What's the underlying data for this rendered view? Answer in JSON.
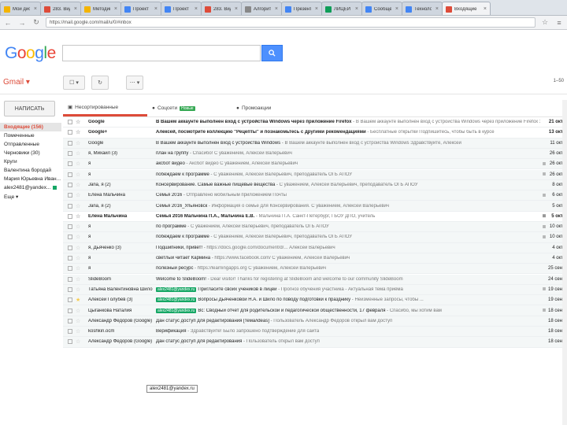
{
  "browser": {
    "tabs": [
      {
        "label": "Мой диск",
        "color": "#f4b400"
      },
      {
        "label": "283. Видео",
        "color": "#dd4b39"
      },
      {
        "label": "Методика",
        "color": "#f4b400"
      },
      {
        "label": "Проект",
        "color": "#4285f4"
      },
      {
        "label": "Проект",
        "color": "#4285f4"
      },
      {
        "label": "283. Видео",
        "color": "#dd4b39"
      },
      {
        "label": "Алгоритм",
        "color": "#888888"
      },
      {
        "label": "Презентация",
        "color": "#4285f4"
      },
      {
        "label": "ЛИЦЕЙ",
        "color": "#0f9d58"
      },
      {
        "label": "Сообщения",
        "color": "#4285f4"
      },
      {
        "label": "Технолог",
        "color": "#4285f4"
      },
      {
        "label": "Входящие",
        "color": "#dd4b39"
      }
    ],
    "url": "https://mail.google.com/mail/u/0/#inbox"
  },
  "header": {
    "logo": "Google",
    "search_placeholder": ""
  },
  "toolbar": {
    "app_label": "Gmail ▾",
    "pager": "1–50"
  },
  "sidebar": {
    "compose": "НАПИСАТЬ",
    "items": [
      {
        "label": "Входящие (156)",
        "active": true
      },
      {
        "label": "Помеченные"
      },
      {
        "label": "Отправленные"
      },
      {
        "label": "Черновики (30)"
      },
      {
        "label": "Круги"
      },
      {
        "label": "Валентина бородай"
      },
      {
        "label": "Мария Юрьевна Иван...",
        "dot": "#dd4b39"
      },
      {
        "label": "alex2481@yandex...",
        "dot": "#16a765"
      },
      {
        "label": "Еще ▾"
      }
    ]
  },
  "categories": [
    {
      "label": "Несортированные",
      "icon": "inbox-icon",
      "active": true
    },
    {
      "label": "Соцсети",
      "badge": "Новые"
    },
    {
      "label": "Промоакции"
    }
  ],
  "emails": [
    {
      "sender": "Google",
      "subject": "В Вашем аккаунте выполнен вход с устройства Windows через приложение Firefox",
      "snippet": " - В Вашем аккаунте выполнен вход с устройства Windows через приложение Firefox Здравствуйте, Але",
      "date": "21 окт.",
      "unread": true
    },
    {
      "sender": "Google+",
      "subject": "Алексей, посмотрите коллекцию \"Рецепты\" и познакомьтесь с другими рекомендациями",
      "snippet": " - Бесплатные открытки Подпишитесь, чтобы быть в курсе",
      "date": "13 окт.",
      "unread": true
    },
    {
      "sender": "Google",
      "subject": "В Вашем аккаунте выполнен вход с устройства Windows",
      "snippet": " - В Вашем аккаунте выполнен вход с устройства Windows Здравствуйте, Алексей",
      "date": "11 окт.",
      "unread": false
    },
    {
      "sender": "я, Михаил (3)",
      "subject": "план на группу",
      "snippet": " - Спасибо! С уважением, Алексей Валерьевич",
      "date": "26 окт.",
      "unread": false
    },
    {
      "sender": "я",
      "subject": "аксбот видео",
      "snippet": " - Аксбот видео С уважением, Алексей Валерьевич",
      "date": "26 окт.",
      "unread": false,
      "attach": true
    },
    {
      "sender": "я",
      "subject": "побеждаем к программе",
      "snippet": " - С уважением, Алексей Валерьевич, преподаватель ОГБ АПОУ",
      "date": "26 окт.",
      "unread": false,
      "attach": true
    },
    {
      "sender": "Jana, я (2)",
      "subject": "Консервирование. Самые важные пищевые вещества",
      "snippet": " - С уважением, Алексей Валерьевич, преподаватель ОГБ АПОУ",
      "date": "8 окт.",
      "unread": false
    },
    {
      "sender": "Елена Мальчина",
      "subject": "Семья 2016",
      "snippet": " - Отправлено мобильным приложением Почты",
      "date": "6 окт.",
      "unread": false,
      "attach": true
    },
    {
      "sender": "Jana, я (2)",
      "subject": "Семья 2016_Ульяновск",
      "snippet": " - Информация о семье для Консервирования. С уважением, Алексей Валерьевич",
      "date": "5 окт.",
      "unread": false
    },
    {
      "sender": "Елена Мальчина",
      "subject": "Семья 2016 Мальчина П.А., Мальчина Е.В.",
      "snippet": " - Мальчина П.А. Санкт-Петербург, ГБОУ ДПО, учитель",
      "date": "5 окт.",
      "unread": true,
      "attach": true
    },
    {
      "sender": "я",
      "subject": "по программе",
      "snippet": " - С уважением, Алексей Валерьевич, преподаватель ОГБ АПОУ",
      "date": "10 окт.",
      "unread": false,
      "attach": true
    },
    {
      "sender": "я",
      "subject": "побеждаем к программе",
      "snippet": " - С уважением, Алексей Валерьевич, преподаватель ОГБ АПОУ",
      "date": "10 окт.",
      "unread": false,
      "attach": true
    },
    {
      "sender": "я, Дьяченко (3)",
      "subject": "Подшипники, привет!",
      "snippet": " - https://docs.google.com/document/d/... Алексей Валерьевич",
      "date": "4 окт.",
      "unread": false
    },
    {
      "sender": "я",
      "subject": "светлый читает Кармина",
      "snippet": " - https://www.facebook.com/ С уважением, Алексей Валерьевич",
      "date": "4 окт.",
      "unread": false
    },
    {
      "sender": "я",
      "subject": "полезный ресурс",
      "snippet": " - https://learningapps.org С уважением, Алексей Валерьевич",
      "date": "25 сент.",
      "unread": false
    },
    {
      "sender": "SlideBoom",
      "subject": "Welcome to SlideBoom!",
      "snippet": " - Dear visitor! Thanks for registering at SlideBoom and welcome to our community SlideBoom",
      "date": "24 сент.",
      "unread": false
    },
    {
      "sender": "Татьяна Валентиновна Шило",
      "label": "alex2481@yandex.ru",
      "subject": "Пригласите своих учеников в лицей",
      "snippet": " - Прогноз обучения участника - Актуальная тема приёма",
      "date": "19 сент.",
      "unread": false,
      "attach": true
    },
    {
      "sender": "Алексей Голубев (3)",
      "label": "alex2481@yandex.ru",
      "subject": "Вопросы Дьяченковой Н.А. и Шило по поводу подготовки к празднику",
      "snippet": " - Неизменные запросы, чтобы ...",
      "date": "19 сент.",
      "unread": false,
      "star": true
    },
    {
      "sender": "Цыганкова Наталия",
      "label": "alex2481@yandex.ru",
      "subject": "Вс: Сводный отчет для родительской и педагогической общественности, 17 февраля",
      "snippet": " - Спасибо, мы хотим вам",
      "date": "18 сент.",
      "unread": false,
      "attach": true
    },
    {
      "sender": "Александр Федоров (Google)",
      "subject": "Дан статус доступ для редактирования [тема/ideas]",
      "snippet": " - Пользователь Александр Федоров открыл вам доступ",
      "date": "18 сент.",
      "unread": false
    },
    {
      "sender": "koshkin.ocm",
      "subject": "Верификация",
      "snippet": " - Здравствуйте! Было запрошено подтверждение для сайта",
      "date": "18 сент.",
      "unread": false
    },
    {
      "sender": "Александр Федоров (Google)",
      "subject": "Дан статус доступ для редактирования",
      "snippet": " - Пользователь открыл вам доступ",
      "date": "18 сент.",
      "unread": false
    }
  ],
  "tooltip": "alex2481@yandex.ru"
}
